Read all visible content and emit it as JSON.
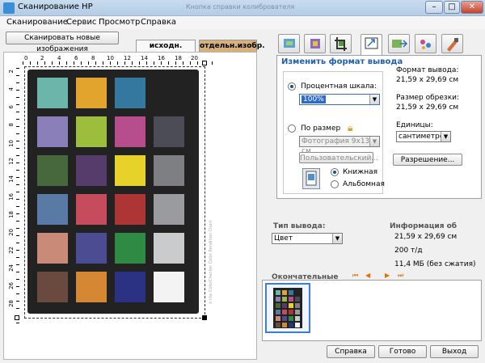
{
  "window": {
    "title": "Сканирование HP",
    "background_caption": "Кнопка справки колибрователя",
    "controls": {
      "minimize": "–",
      "maximize": "□",
      "close": "✕"
    }
  },
  "menu": {
    "items": [
      "Сканирование",
      "Сервис",
      "Просмотр",
      "Справка"
    ]
  },
  "left": {
    "scan_new_button": "Сканировать новые изображения",
    "tab_original": "исходн. изобр.",
    "tab_separate": "отдельн.изобр.",
    "ruler_top": [
      "0",
      "2",
      "4",
      "6",
      "8",
      "10",
      "12",
      "14",
      "16",
      "18",
      "20"
    ],
    "ruler_left": [
      "2",
      "4",
      "6",
      "8",
      "10",
      "12",
      "14",
      "16",
      "18",
      "20",
      "22",
      "24",
      "26",
      "28"
    ],
    "chart_label": "x-rite ColorChecker Color Rendition Chart",
    "patch_colors": [
      "#6cb5ab",
      "#e3a42d",
      "#3478a0",
      "#222222",
      "#8a7fb8",
      "#9dbe3d",
      "#b74d8d",
      "#4b4c55",
      "#46683c",
      "#563c6b",
      "#e7d22a",
      "#7d7f82",
      "#587aa5",
      "#c64c5d",
      "#ad3535",
      "#9a9b9e",
      "#c98b78",
      "#4c4c92",
      "#2f8a43",
      "#c9cbcd",
      "#6a4a3e",
      "#d58734",
      "#2b3283",
      "#f3f3f3"
    ]
  },
  "right": {
    "tool_icons": [
      "scan-image-icon",
      "color-adjust-icon",
      "crop-icon",
      "resize-icon",
      "output-icon",
      "settings-icon",
      "sharpen-icon"
    ],
    "section_title": "Изменить формат вывода",
    "percent_label": "Процентная шкала:",
    "percent_value": "100%",
    "by_size_label": "По размер",
    "size_combo_value": "Фотография 9x13 см",
    "custom_button": "Пользовательский...",
    "orientation_portrait": "Книжная",
    "orientation_landscape": "Альбомная",
    "output_format_label": "Формат вывода:",
    "output_format_value": "21,59 x 29,69 см",
    "crop_size_label": "Размер обрезки:",
    "crop_size_value": "21,59 x 29,69 см",
    "units_label": "Единицы:",
    "units_value": "сантиметро",
    "resolution_button": "Разрешение...",
    "output_type_label": "Тип вывода:",
    "output_type_value": "Цвет",
    "info_label": "Информация об",
    "info_size": "21,59 x 29,69 см",
    "info_dpi": "200 т/д",
    "info_memory": "11,4 МБ (без сжатия)",
    "final_label": "Окончательные",
    "nav_icons": [
      "first-icon",
      "prev-icon",
      "next-icon",
      "last-icon"
    ]
  },
  "footer": {
    "help": "Справка",
    "done": "Готово",
    "exit": "Выход"
  }
}
